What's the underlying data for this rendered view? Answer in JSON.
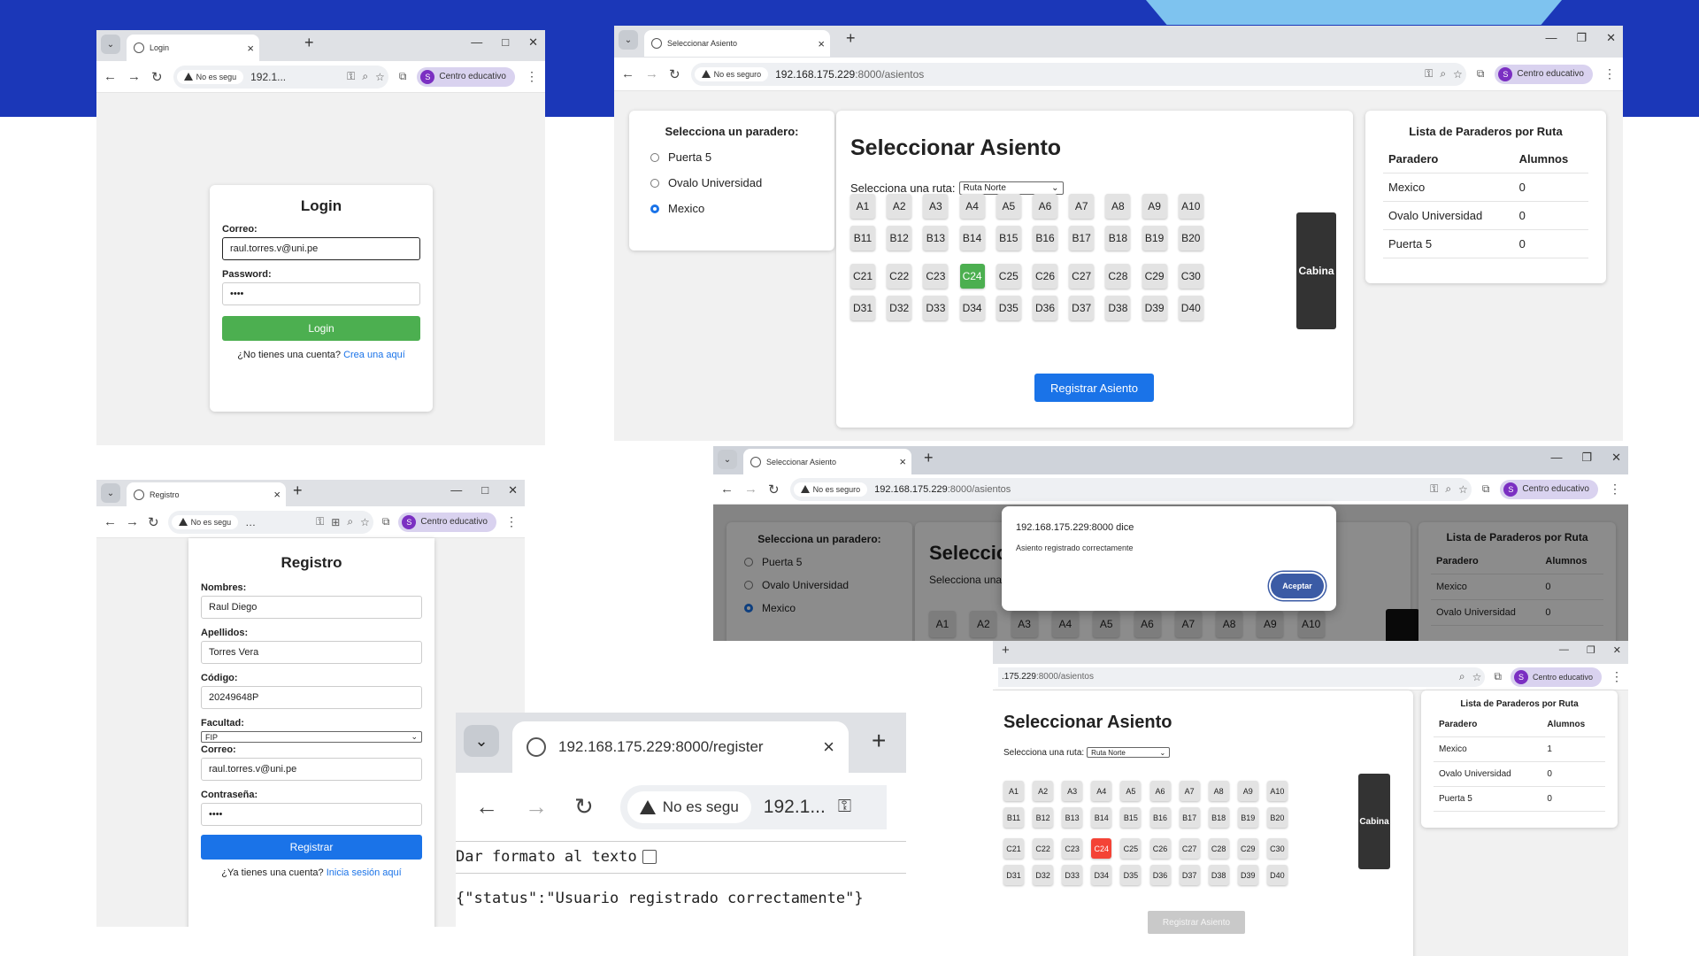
{
  "colors": {
    "accent_blue": "#1a73e8",
    "green": "#4caf50",
    "red": "#f44336",
    "bg_blue": "#1b37b8",
    "light_blue": "#7ec3ef",
    "cabin": "#333333"
  },
  "common": {
    "no_seguro": "No es seguro",
    "no_seguro_short": "No es segu",
    "profile_label": "Centro educativo",
    "profile_initial": "S",
    "url_host": "192.168.175.229",
    "url_path_asientos": ":8000/asientos",
    "url_truncated": "192.1..."
  },
  "login": {
    "tab_title": "Login",
    "heading": "Login",
    "correo_label": "Correo:",
    "correo_value": "raul.torres.v@uni.pe",
    "password_label": "Password:",
    "password_value": "••••",
    "button": "Login",
    "no_account": "¿No tienes una cuenta?",
    "create_link": "Crea una aquí"
  },
  "seat_page": {
    "tab_title": "Seleccionar Asiento",
    "stops_heading": "Selecciona un paradero:",
    "stops": [
      "Puerta 5",
      "Ovalo Universidad",
      "Mexico"
    ],
    "selected_stop": "Mexico",
    "title": "Seleccionar Asiento",
    "route_label": "Selecciona una ruta:",
    "route_value": "Ruta Norte",
    "cabin_label": "Cabina",
    "register_button": "Registrar Asiento",
    "list_heading": "Lista de Paraderos por Ruta",
    "col_stop": "Paradero",
    "col_students": "Alumnos",
    "seats": [
      [
        "A1",
        "A2",
        "A3",
        "A4",
        "A5",
        "A6",
        "A7",
        "A8",
        "A9",
        "A10"
      ],
      [
        "B11",
        "B12",
        "B13",
        "B14",
        "B15",
        "B16",
        "B17",
        "B18",
        "B19",
        "B20"
      ],
      [
        "C21",
        "C22",
        "C23",
        "C24",
        "C25",
        "C26",
        "C27",
        "C28",
        "C29",
        "C30"
      ],
      [
        "D31",
        "D32",
        "D33",
        "D34",
        "D35",
        "D36",
        "D37",
        "D38",
        "D39",
        "D40"
      ]
    ],
    "selected_seat": "C24",
    "rows_before": [
      [
        "Mexico",
        "0"
      ],
      [
        "Ovalo Universidad",
        "0"
      ],
      [
        "Puerta 5",
        "0"
      ]
    ],
    "rows_after": [
      [
        "Mexico",
        "1"
      ],
      [
        "Ovalo Universidad",
        "0"
      ],
      [
        "Puerta 5",
        "0"
      ]
    ]
  },
  "dialog": {
    "origin": "192.168.175.229:8000 dice",
    "message": "Asiento registrado correctamente",
    "accept": "Aceptar"
  },
  "after": {
    "url_partial": ".175.229",
    "url_partial_path": ":8000/asientos",
    "register_button_disabled": "Registrar Asiento"
  },
  "registro": {
    "tab_title": "Registro",
    "heading": "Registro",
    "fields": [
      {
        "label": "Nombres:",
        "value": "Raul Diego"
      },
      {
        "label": "Apellidos:",
        "value": "Torres Vera"
      },
      {
        "label": "Código:",
        "value": "20249648P"
      }
    ],
    "facultad_label": "Facultad:",
    "facultad_value": "FIP",
    "correo_label": "Correo:",
    "correo_value": "raul.torres.v@uni.pe",
    "password_label": "Contraseña:",
    "password_value": "••••",
    "button": "Registrar",
    "has_account": "¿Ya tienes una cuenta?",
    "login_link": "Inicia sesión aquí"
  },
  "json_view": {
    "tab_url": "192.168.175.229:8000/register",
    "no_seguro": "No es segu",
    "url_truncated": "192.1...",
    "pretty_print": "Dar formato al texto",
    "body": "{\"status\":\"Usuario registrado correctamente\"}"
  }
}
